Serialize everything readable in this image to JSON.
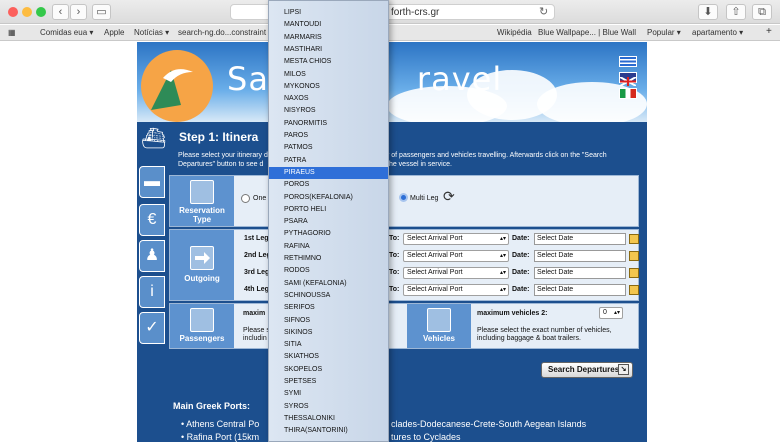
{
  "browser": {
    "url": "forth-crs.gr",
    "tab_glyph": "▭",
    "bookmarks": [
      "Comidas eua ▾",
      "Apple",
      "Notícias ▾",
      "search-ng.do...constraint",
      "Wikipédia",
      "Blue Wallpape... | Blue Wall",
      "Popular ▾",
      "apartamento ▾"
    ]
  },
  "site": {
    "brand_left": "Sa",
    "brand_right": "ravel",
    "step_title": "Step 1: Itinera",
    "intro_line1": "Please select your itinerary d",
    "intro_line1b": "r of passengers and vehicles travelling. Afterwards click on the \"Search",
    "intro_line2": "Departures\" button to see d",
    "intro_line2b": "the vessel in service.",
    "reservation_type": "Reservation Type",
    "one_way": "One",
    "multi_leg": "Multi Leg",
    "outgoing": "Outgoing",
    "legs": [
      {
        "label": "1st Leg",
        "to": "To:",
        "arrival": "Select Arrival Port",
        "date_label": "Date:",
        "date": "Select Date"
      },
      {
        "label": "2nd Leg",
        "to": "To:",
        "arrival": "Select Arrival Port",
        "date_label": "Date:",
        "date": "Select Date"
      },
      {
        "label": "3rd Leg",
        "to": "To:",
        "arrival": "Select Arrival Port",
        "date_label": "Date:",
        "date": "Select Date"
      },
      {
        "label": "4th Leg",
        "to": "To:",
        "arrival": "Select Arrival Port",
        "date_label": "Date:",
        "date": "Select Date"
      }
    ],
    "passengers": "Passengers",
    "pass_max": "maxim",
    "pass_note1": "Please s",
    "pass_note2": "includin",
    "vehicles": "Vehicles",
    "veh_max": "maximum vehicles 2:",
    "veh_value": "0",
    "veh_note1": "Please select the exact number of vehicles,",
    "veh_note2": "including baggage & boat trailers.",
    "search_button": "Search Departures",
    "ports_heading": "Main Greek Ports:",
    "port1a": "Athens Central Po",
    "port1b": "clades-Dodecanese-Crete-South Aegean Islands",
    "port2a": "Rafina Port (15km",
    "port2b": "tures to Cyclades"
  },
  "dropdown": {
    "selected_index": 14,
    "options": [
      "LIPSI",
      "MANTOUDI",
      "MARMARIS",
      "MASTIHARI",
      "MESTA CHIOS",
      "MILOS",
      "MYKONOS",
      "NAXOS",
      "NISYROS",
      "PANORMITIS",
      "PAROS",
      "PATMOS",
      "PATRA",
      "PIRAEUS",
      "POROS",
      "POROS(KEFALONIA)",
      "PORTO HELI",
      "PSARA",
      "PYTHAGORIO",
      "RAFINA",
      "RETHIMNO",
      "RODOS",
      "SAMI (KEFALONIA)",
      "SCHINOUSSA",
      "SERIFOS",
      "SIFNOS",
      "SIKINOS",
      "SITIA",
      "SKIATHOS",
      "SKOPELOS",
      "SPETSES",
      "SYMI",
      "SYROS",
      "THESSALONIKI",
      "THIRA(SANTORINI)"
    ]
  }
}
